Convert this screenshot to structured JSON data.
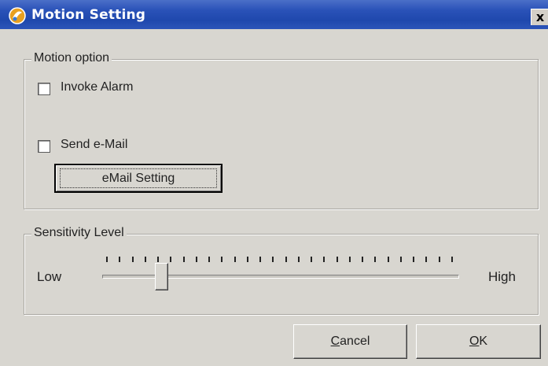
{
  "window": {
    "title": "Motion Setting",
    "close_glyph": "x"
  },
  "motion_option": {
    "legend": "Motion option",
    "invoke_alarm": {
      "label": "Invoke Alarm",
      "checked": false
    },
    "send_email": {
      "label": "Send e-Mail",
      "checked": false
    },
    "email_setting_button": "eMail Setting"
  },
  "sensitivity": {
    "legend": "Sensitivity Level",
    "low_label": "Low",
    "high_label": "High",
    "level_fraction": 0.16,
    "tick_count": 28
  },
  "buttons": {
    "cancel_hotkey": "C",
    "cancel_rest": "ancel",
    "ok_hotkey": "O",
    "ok_rest": "K"
  },
  "icons": {
    "app": "motion-app-icon",
    "close": "close-icon"
  },
  "colors": {
    "title_bar": "#2a52b8",
    "dialog_face": "#d8d6d0"
  }
}
